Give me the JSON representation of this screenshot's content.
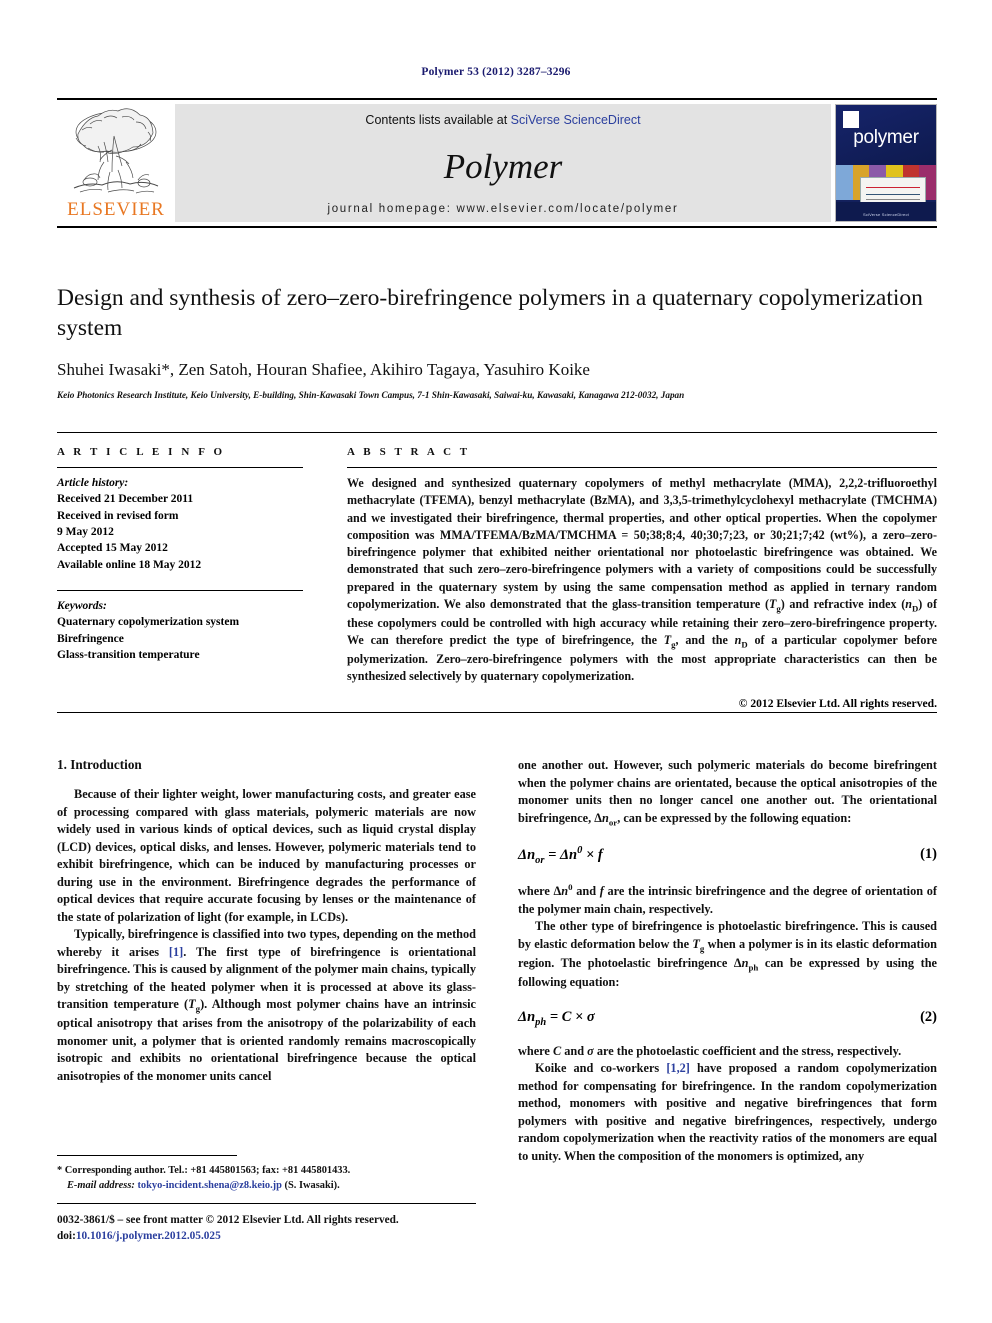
{
  "running_head": "Polymer 53 (2012) 3287–3296",
  "masthead": {
    "contents_prefix": "Contents lists available at ",
    "sciencedirect_link": "SciVerse ScienceDirect",
    "journal_name": "Polymer",
    "homepage": "journal homepage: www.elsevier.com/locate/polymer",
    "publisher_logo_text": "ELSEVIER",
    "cover": {
      "title": "polymer",
      "caption": "SciVerse ScienceDirect"
    }
  },
  "article": {
    "title": "Design and synthesis of zero–zero-birefringence polymers in a quaternary copolymerization system",
    "authors": "Shuhei Iwasaki*, Zen Satoh, Houran Shafiee, Akihiro Tagaya, Yasuhiro Koike",
    "affiliation": "Keio Photonics Research Institute, Keio University, E-building, Shin-Kawasaki Town Campus, 7-1 Shin-Kawasaki, Saiwai-ku, Kawasaki, Kanagawa 212-0032, Japan"
  },
  "info": {
    "heading": "A R T I C L E  I N F O",
    "history_label": "Article history:",
    "history": [
      "Received 21 December 2011",
      "Received in revised form",
      "9 May 2012",
      "Accepted 15 May 2012",
      "Available online 18 May 2012"
    ],
    "keywords_label": "Keywords:",
    "keywords": [
      "Quaternary copolymerization system",
      "Birefringence",
      "Glass-transition temperature"
    ]
  },
  "abstract": {
    "heading": "A B S T R A C T",
    "body": "We designed and synthesized quaternary copolymers of methyl methacrylate (MMA), 2,2,2-trifluoroethyl methacrylate (TFEMA), benzyl methacrylate (BzMA), and 3,3,5-trimethylcyclohexyl methacrylate (TMCHMA) and we investigated their birefringence, thermal properties, and other optical properties. When the copolymer composition was MMA/TFEMA/BzMA/TMCHMA = 50;38;8;4, 40;30;7;23, or 30;21;7;42 (wt%), a zero–zero-birefringence polymer that exhibited neither orientational nor photoelastic birefringence was obtained. We demonstrated that such zero–zero-birefringence polymers with a variety of compositions could be successfully prepared in the quaternary system by using the same compensation method as applied in ternary random copolymerization. We also demonstrated that the glass-transition temperature (Tg) and refractive index (nD) of these copolymers could be controlled with high accuracy while retaining their zero–zero-birefringence property. We can therefore predict the type of birefringence, the Tg, and the nD of a particular copolymer before polymerization. Zero–zero-birefringence polymers with the most appropriate characteristics can then be synthesized selectively by quaternary copolymerization.",
    "copyright": "© 2012 Elsevier Ltd. All rights reserved."
  },
  "body": {
    "section1_heading": "1.  Introduction",
    "left_paragraphs": [
      "Because of their lighter weight, lower manufacturing costs, and greater ease of processing compared with glass materials, polymeric materials are now widely used in various kinds of optical devices, such as liquid crystal display (LCD) devices, optical disks, and lenses. However, polymeric materials tend to exhibit birefringence, which can be induced by manufacturing processes or during use in the environment. Birefringence degrades the performance of optical devices that require accurate focusing by lenses or the maintenance of the state of polarization of light (for example, in LCDs).",
      "Typically, birefringence is classified into two types, depending on the method whereby it arises [1]. The first type of birefringence is orientational birefringence. This is caused by alignment of the polymer main chains, typically by stretching of the heated polymer when it is processed at above its glass-transition temperature (Tg). Although most polymer chains have an intrinsic optical anisotropy that arises from the anisotropy of the polarizability of each monomer unit, a polymer that is oriented randomly remains macroscopically isotropic and exhibits no orientational birefringence because the optical anisotropies of the monomer units cancel"
    ],
    "right_paragraphs": [
      "one another out. However, such polymeric materials do become birefringent when the polymer chains are orientated, because the optical anisotropies of the monomer units then no longer cancel one another out. The orientational birefringence, Δnor, can be expressed by the following equation:",
      "where Δn0 and f are the intrinsic birefringence and the degree of orientation of the polymer main chain, respectively.",
      "The other type of birefringence is photoelastic birefringence. This is caused by elastic deformation below the Tg when a polymer is in its elastic deformation region. The photoelastic birefringence Δnph can be expressed by using the following equation:",
      "where C and σ are the photoelastic coefficient and the stress, respectively.",
      "Koike and co-workers [1,2] have proposed a random copolymerization method for compensating for birefringence. In the random copolymerization method, monomers with positive and negative birefringences that form polymers with positive and negative birefringences, respectively, undergo random copolymerization when the reactivity ratios of the monomers are equal to unity. When the composition of the monomers is optimized, any"
    ],
    "equations": [
      {
        "number": "(1)",
        "text": "Δnor = Δn0 × f"
      },
      {
        "number": "(2)",
        "text": "Δnph = C × σ"
      }
    ],
    "citations": {
      "ref1": "[1]",
      "ref12": "[1,2]"
    }
  },
  "footnotes": {
    "corresponding": "* Corresponding author. Tel.: +81 445801563; fax: +81 445801433.",
    "email_label": "E-mail address:",
    "email": "tokyo-incident.shena@z8.keio.jp",
    "email_suffix": "(S. Iwasaki).",
    "issn_line": "0032-3861/$ – see front matter © 2012 Elsevier Ltd. All rights reserved.",
    "doi_label": "doi:",
    "doi": "10.1016/j.polymer.2012.05.025"
  },
  "colors": {
    "link": "#2b3f9e",
    "elsevier_orange": "#E87722",
    "running_head": "#1a1a6e",
    "masthead_bg": "#e3e3e3",
    "cover_bg": "#13205c"
  }
}
